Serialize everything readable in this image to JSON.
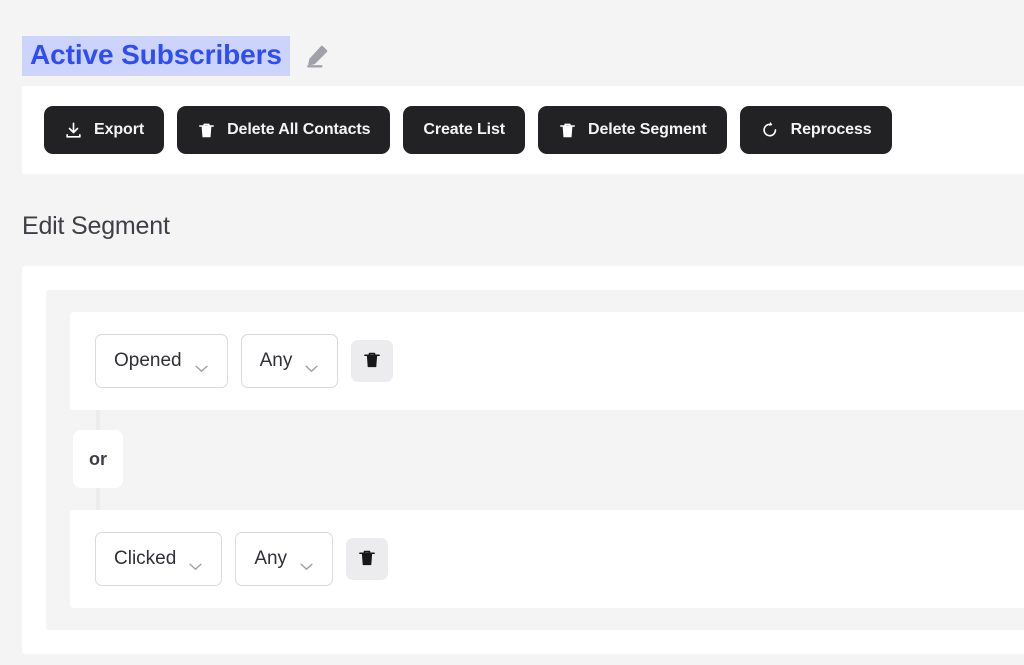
{
  "header": {
    "segment_name": "Active Subscribers",
    "edit_icon": "pencil-icon",
    "name_highlight_color": "#ccd4fb",
    "name_text_color": "#2f4df6"
  },
  "toolbar": {
    "buttons": [
      {
        "label": "Export",
        "icon": "download-icon"
      },
      {
        "label": "Delete All Contacts",
        "icon": "trash-icon"
      },
      {
        "label": "Create List",
        "icon": "none"
      },
      {
        "label": "Delete Segment",
        "icon": "trash-icon"
      },
      {
        "label": "Reprocess",
        "icon": "refresh-icon"
      }
    ],
    "button_bg": "#222225",
    "button_text_color": "#f4f4f5"
  },
  "section": {
    "heading": "Edit Segment"
  },
  "builder": {
    "conditions": [
      {
        "field": "Opened",
        "field_chevron": "chevron-down-icon",
        "operator": "Any",
        "operator_chevron": "chevron-down-icon",
        "delete_icon": "trash-icon"
      },
      {
        "field": "Clicked",
        "field_chevron": "chevron-down-icon",
        "operator": "Any",
        "operator_chevron": "chevron-down-icon",
        "delete_icon": "trash-icon"
      }
    ],
    "connector_label": "or"
  }
}
